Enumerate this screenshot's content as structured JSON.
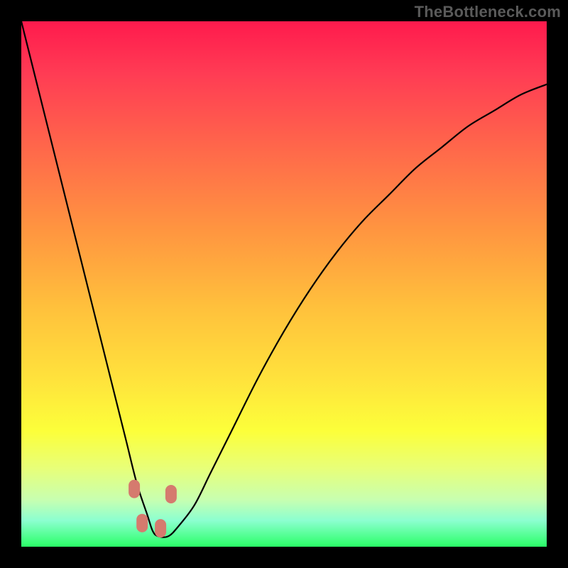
{
  "watermark": "TheBottleneck.com",
  "colors": {
    "frame": "#000000",
    "marker": "#d57a6e",
    "curve": "#000000",
    "gradient_top": "#ff1a4d",
    "gradient_bottom": "#2aff67"
  },
  "chart_data": {
    "type": "line",
    "title": "",
    "xlabel": "",
    "ylabel": "",
    "xlim": [
      0,
      100
    ],
    "ylim": [
      0,
      100
    ],
    "grid": false,
    "legend": false,
    "annotations": [
      "TheBottleneck.com"
    ],
    "series": [
      {
        "name": "bottleneck-curve",
        "x": [
          0,
          5,
          10,
          15,
          18,
          20,
          22,
          24,
          25,
          26,
          28,
          30,
          33,
          36,
          40,
          45,
          50,
          55,
          60,
          65,
          70,
          75,
          80,
          85,
          90,
          95,
          100
        ],
        "y": [
          100,
          80,
          60,
          40,
          28,
          20,
          12,
          6,
          3,
          2,
          2,
          4,
          8,
          14,
          22,
          32,
          41,
          49,
          56,
          62,
          67,
          72,
          76,
          80,
          83,
          86,
          88
        ]
      }
    ],
    "markers": [
      {
        "x": 21.5,
        "y": 11
      },
      {
        "x": 23.0,
        "y": 4.5
      },
      {
        "x": 26.5,
        "y": 3.5
      },
      {
        "x": 28.5,
        "y": 10
      }
    ]
  }
}
